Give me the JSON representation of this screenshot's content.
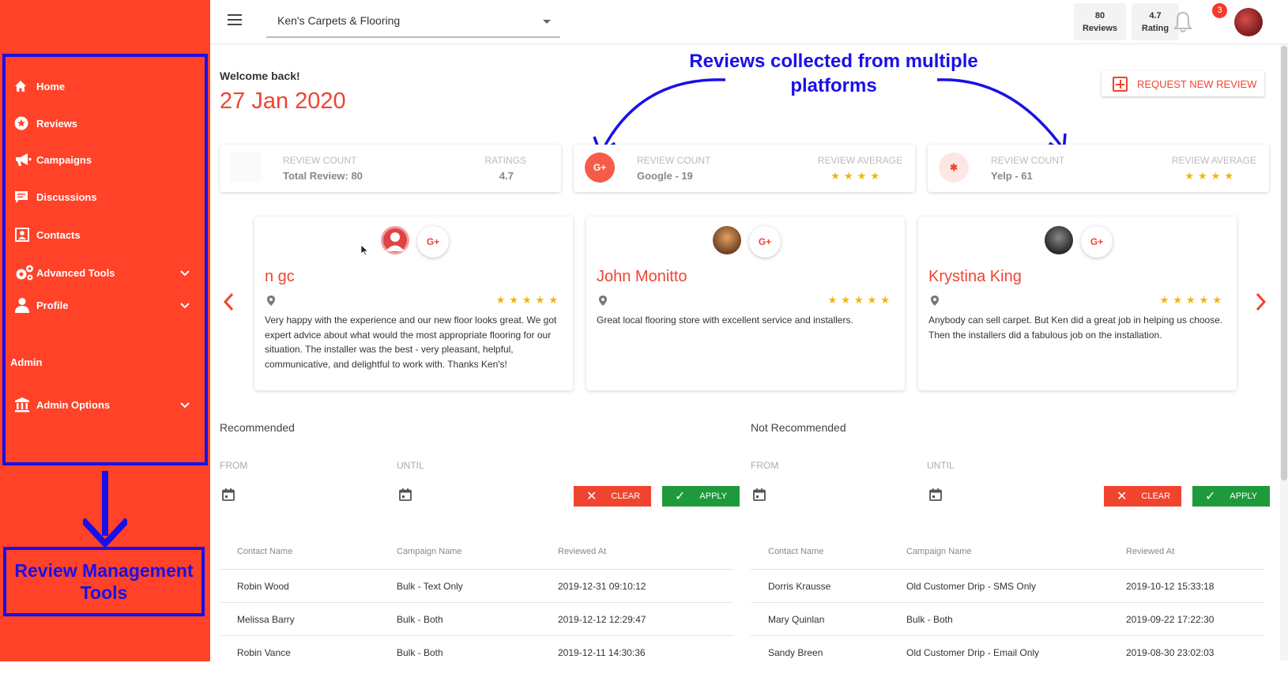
{
  "sidebar": {
    "items": [
      {
        "label": "Home",
        "icon": "home-icon"
      },
      {
        "label": "Reviews",
        "icon": "star-circle-icon"
      },
      {
        "label": "Campaigns",
        "icon": "megaphone-icon"
      },
      {
        "label": "Discussions",
        "icon": "chat-icon"
      },
      {
        "label": "Contacts",
        "icon": "contacts-icon"
      },
      {
        "label": "Advanced Tools",
        "icon": "gears-icon"
      },
      {
        "label": "Profile",
        "icon": "person-icon"
      }
    ],
    "admin_label": "Admin",
    "admin_options_label": "Admin Options",
    "annotation": "Review Management Tools"
  },
  "header": {
    "business": "Ken's Carpets & Flooring",
    "reviews_count": "80",
    "reviews_label": "Reviews",
    "rating_value": "4.7",
    "rating_label": "Rating",
    "notification_count": "3"
  },
  "main": {
    "welcome": "Welcome back!",
    "date": "27 Jan 2020",
    "annotation": "Reviews collected from multiple platforms",
    "request_button": "REQUEST NEW REVIEW"
  },
  "stats": [
    {
      "label1": "REVIEW COUNT",
      "value1": "Total Review: 80",
      "label2": "RATINGS",
      "value2": "4.7"
    },
    {
      "label1": "REVIEW COUNT",
      "value1": "Google - 19",
      "label2": "REVIEW AVERAGE",
      "stars": "★★★★",
      "icon_text": "G+"
    },
    {
      "label1": "REVIEW COUNT",
      "value1": "Yelp - 61",
      "label2": "REVIEW AVERAGE",
      "stars": "★★★★",
      "icon_text": "✱"
    }
  ],
  "reviews": [
    {
      "name": "n gc",
      "stars": "★★★★★",
      "source": "G+",
      "text": "Very happy with the experience and our new floor looks great. We got expert advice about what would the most appropriate flooring for our situation. The installer was the best - very pleasant, helpful, communicative, and delightful to work with. Thanks Ken's!"
    },
    {
      "name": "John Monitto",
      "stars": "★★★★★",
      "source": "G+",
      "text": "Great local flooring store with excellent service and installers."
    },
    {
      "name": "Krystina King",
      "stars": "★★★★★",
      "source": "G+",
      "text": "Anybody can sell carpet. But Ken did a great job in helping us choose. Then the installers did a fabulous job on the installation."
    }
  ],
  "filters": {
    "recommended_title": "Recommended",
    "not_recommended_title": "Not Recommended",
    "from_label": "FROM",
    "until_label": "UNTIL",
    "clear_label": "CLEAR",
    "apply_label": "APPLY"
  },
  "tables": {
    "headers": [
      "Contact Name",
      "Campaign Name",
      "Reviewed At"
    ],
    "recommended": [
      [
        "Robin Wood",
        "Bulk - Text Only",
        "2019-12-31 09:10:12"
      ],
      [
        "Melissa Barry",
        "Bulk - Both",
        "2019-12-12 12:29:47"
      ],
      [
        "Robin Vance",
        "Bulk - Both",
        "2019-12-11 14:30:36"
      ]
    ],
    "not_recommended": [
      [
        "Dorris Krausse",
        "Old Customer Drip - SMS Only",
        "2019-10-12 15:33:18"
      ],
      [
        "Mary Quinlan",
        "Bulk - Both",
        "2019-09-22 17:22:30"
      ],
      [
        "Sandy Breen",
        "Old Customer Drip - Email Only",
        "2019-08-30 23:02:03"
      ]
    ]
  },
  "colors": {
    "brand_red": "#ff4228",
    "annotation_blue": "#1a10e6",
    "apply_green": "#1f9a3b",
    "star": "#f5b400"
  }
}
